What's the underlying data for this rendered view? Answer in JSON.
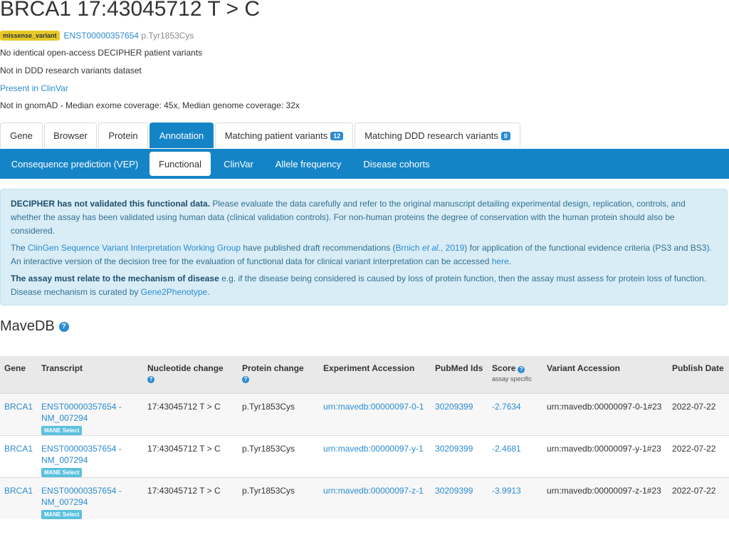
{
  "header": {
    "title": "BRCA1 17:43045712 T > C",
    "consequence_badge": "missense_variant",
    "transcript": "ENST00000357654",
    "protein_change": "p.Tyr1853Cys"
  },
  "info_lines": [
    "No identical open-access DECIPHER patient variants",
    "Not in DDD research variants dataset",
    "Present in ClinVar",
    "Not in gnomAD - Median exome coverage: 45x, Median genome coverage: 32x"
  ],
  "tabs": [
    {
      "label": "Gene"
    },
    {
      "label": "Browser"
    },
    {
      "label": "Protein"
    },
    {
      "label": "Annotation"
    },
    {
      "label": "Matching patient variants",
      "count": "12"
    },
    {
      "label": "Matching DDD research variants",
      "count": "0"
    }
  ],
  "subnav": [
    {
      "label": "Consequence prediction (VEP)"
    },
    {
      "label": "Functional"
    },
    {
      "label": "ClinVar"
    },
    {
      "label": "Allele frequency"
    },
    {
      "label": "Disease cohorts"
    }
  ],
  "alert": {
    "p1_bold": "DECIPHER has not validated this functional data.",
    "p1_text": " Please evaluate the data carefully and refer to the original manuscript detailing experimental design, replication, controls, and whether the assay has been validated using human data (clinical validation controls). For non-human proteins the degree of conservation with the human protein should also be considered.",
    "p2_pre": "The ",
    "p2_link1": "ClinGen Sequence Variant Interpretation Working Group",
    "p2_mid": " have published draft recommendations (",
    "p2_link2a": "Brnich ",
    "p2_link2b": "et al.",
    "p2_link2c": ", 2019",
    "p2_post": ") for application of the functional evidence criteria (PS3 and BS3). An interactive version of the decision tree for the evaluation of functional data for clinical variant interpretation can be accessed ",
    "p2_link3": "here",
    "p2_end": ".",
    "p3_bold": "The assay must relate to the mechanism of disease",
    "p3_text": " e.g. if the disease being considered is caused by loss of protein function, then the assay must assess for protein loss of function. Disease mechanism is curated by ",
    "p3_link": "Gene2Phenotype",
    "p3_end": "."
  },
  "mavedb": {
    "heading": "MaveDB",
    "help_glyph": "?",
    "columns": {
      "gene": "Gene",
      "transcript": "Transcript",
      "nucleotide": "Nucleotide change",
      "protein": "Protein change",
      "experiment": "Experiment Accession",
      "pubmed": "PubMed Ids",
      "score": "Score",
      "score_sub": "assay specific",
      "variant": "Variant Accession",
      "publish": "Publish Date"
    },
    "rows": [
      {
        "gene": "BRCA1",
        "transcript": "ENST00000357654 - NM_007294",
        "mane": "MANE Select",
        "nucleotide": "17:43045712 T > C",
        "protein": "p.Tyr1853Cys",
        "experiment": "urn:mavedb:00000097-0-1",
        "pubmed": "30209399",
        "score": "-2.7634",
        "variant": "urn:mavedb:00000097-0-1#23",
        "publish": "2022-07-22"
      },
      {
        "gene": "BRCA1",
        "transcript": "ENST00000357654 - NM_007294",
        "mane": "MANE Select",
        "nucleotide": "17:43045712 T > C",
        "protein": "p.Tyr1853Cys",
        "experiment": "urn:mavedb:00000097-y-1",
        "pubmed": "30209399",
        "score": "-2.4681",
        "variant": "urn:mavedb:00000097-y-1#23",
        "publish": "2022-07-22"
      },
      {
        "gene": "BRCA1",
        "transcript": "ENST00000357654 - NM_007294",
        "mane": "MANE Select",
        "nucleotide": "17:43045712 T > C",
        "protein": "p.Tyr1853Cys",
        "experiment": "urn:mavedb:00000097-z-1",
        "pubmed": "30209399",
        "score": "-3.9913",
        "variant": "urn:mavedb:00000097-z-1#23",
        "publish": "2022-07-22"
      }
    ]
  },
  "colors": {
    "primary": "#1584c6",
    "link": "#2a8bd1",
    "alert_bg": "#d9edf7",
    "badge_yellow": "#e6c928",
    "mane_badge": "#5bc0de"
  }
}
